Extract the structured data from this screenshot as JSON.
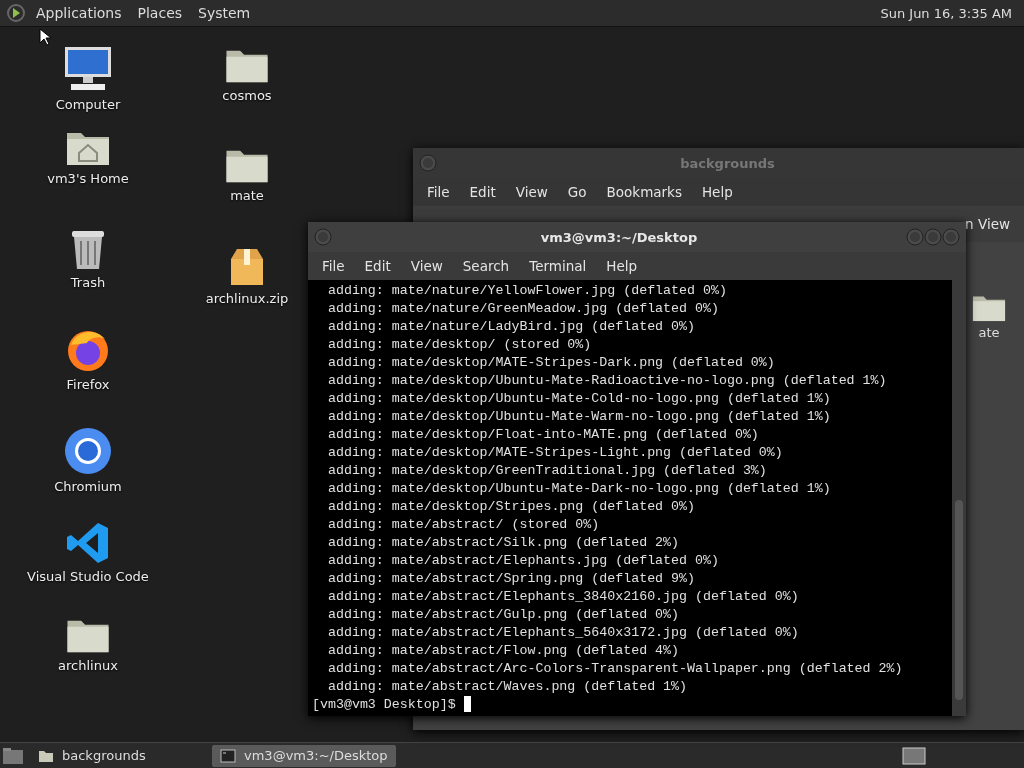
{
  "top_panel": {
    "menus": [
      "Applications",
      "Places",
      "System"
    ],
    "clock": "Sun Jun 16, 3:35 AM"
  },
  "desktop": {
    "columns": [
      {
        "icons": [
          {
            "label": "Computer",
            "kind": "computer"
          },
          {
            "label": "vm3's Home",
            "kind": "home"
          },
          {
            "label": "Trash",
            "kind": "trash"
          },
          {
            "label": "Firefox",
            "kind": "firefox"
          },
          {
            "label": "Chromium",
            "kind": "chromium"
          },
          {
            "label": "Visual Studio Code",
            "kind": "vscode"
          },
          {
            "label": "archlinux",
            "kind": "folder"
          }
        ]
      },
      {
        "icons": [
          {
            "label": "cosmos",
            "kind": "folder"
          },
          {
            "label": "mate",
            "kind": "folder"
          },
          {
            "label": "archlinux.zip",
            "kind": "archive"
          }
        ]
      }
    ]
  },
  "file_manager": {
    "title": "backgrounds",
    "menu": [
      "File",
      "Edit",
      "View",
      "Go",
      "Bookmarks",
      "Help"
    ],
    "toolbar_text": "n View",
    "items": [
      {
        "label": "ate"
      }
    ]
  },
  "terminal": {
    "title": "vm3@vm3:~/Desktop",
    "menu": [
      "File",
      "Edit",
      "View",
      "Search",
      "Terminal",
      "Help"
    ],
    "lines": [
      "adding: mate/nature/YellowFlower.jpg (deflated 0%)",
      "adding: mate/nature/GreenMeadow.jpg (deflated 0%)",
      "adding: mate/nature/LadyBird.jpg (deflated 0%)",
      "adding: mate/desktop/ (stored 0%)",
      "adding: mate/desktop/MATE-Stripes-Dark.png (deflated 0%)",
      "adding: mate/desktop/Ubuntu-Mate-Radioactive-no-logo.png (deflated 1%)",
      "adding: mate/desktop/Ubuntu-Mate-Cold-no-logo.png (deflated 1%)",
      "adding: mate/desktop/Ubuntu-Mate-Warm-no-logo.png (deflated 1%)",
      "adding: mate/desktop/Float-into-MATE.png (deflated 0%)",
      "adding: mate/desktop/MATE-Stripes-Light.png (deflated 0%)",
      "adding: mate/desktop/GreenTraditional.jpg (deflated 3%)",
      "adding: mate/desktop/Ubuntu-Mate-Dark-no-logo.png (deflated 1%)",
      "adding: mate/desktop/Stripes.png (deflated 0%)",
      "adding: mate/abstract/ (stored 0%)",
      "adding: mate/abstract/Silk.png (deflated 2%)",
      "adding: mate/abstract/Elephants.jpg (deflated 0%)",
      "adding: mate/abstract/Spring.png (deflated 9%)",
      "adding: mate/abstract/Elephants_3840x2160.jpg (deflated 0%)",
      "adding: mate/abstract/Gulp.png (deflated 0%)",
      "adding: mate/abstract/Elephants_5640x3172.jpg (deflated 0%)",
      "adding: mate/abstract/Flow.png (deflated 4%)",
      "adding: mate/abstract/Arc-Colors-Transparent-Wallpaper.png (deflated 2%)",
      "adding: mate/abstract/Waves.png (deflated 1%)"
    ],
    "prompt": "[vm3@vm3 Desktop]$"
  },
  "taskbar": {
    "items": [
      {
        "label": "backgrounds",
        "kind": "folder",
        "selected": false
      },
      {
        "label": "vm3@vm3:~/Desktop",
        "kind": "terminal",
        "selected": true
      }
    ]
  }
}
